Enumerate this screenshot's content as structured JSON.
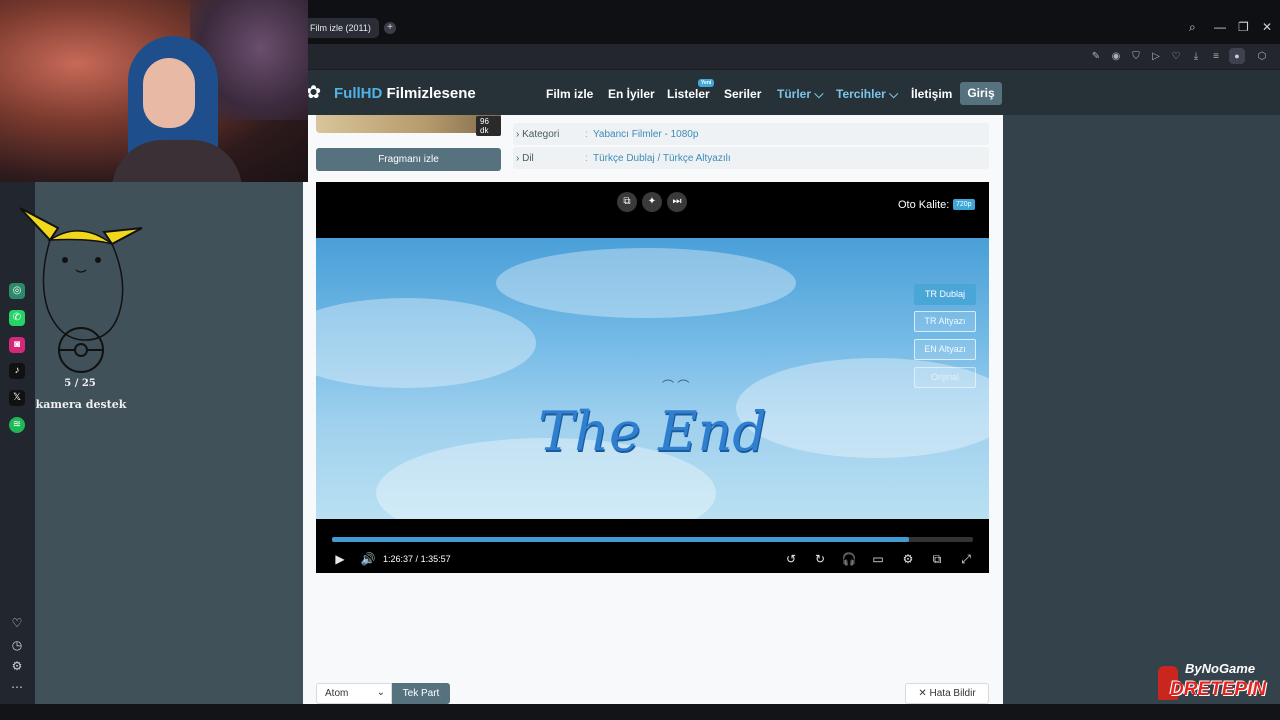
{
  "browser": {
    "tab_title": "Film izle (2011)",
    "new_tab": "+",
    "window_controls": [
      "⌕",
      "—",
      "❐",
      "✕"
    ],
    "toolbar_icons": [
      "edit-icon",
      "camera-icon",
      "shield-icon",
      "play-icon",
      "heart-icon",
      "download-icon",
      "menu-icon",
      "profile-icon"
    ]
  },
  "stream_overlay": {
    "goal_progress": "5 / 25",
    "goal_label": "kamera destek",
    "brand_line1": "ByNoGame",
    "brand_line2": "DRETEPIN",
    "social_icons": [
      "chatgpt-icon",
      "whatsapp-icon",
      "instagram-icon",
      "tiktok-icon",
      "x-icon",
      "spotify-icon"
    ],
    "sidebar_bottom_icons": [
      "heart-icon",
      "clock-icon",
      "gear-icon",
      "more-icon"
    ]
  },
  "site": {
    "logo_part1": "FullHD",
    "logo_part2": "Filmizlesene",
    "nav": {
      "film_izle": "Film izle",
      "en_iyiler": "En İyiler",
      "listeler": "Listeler",
      "listeler_badge": "Yeni",
      "seriler": "Seriler",
      "turler": "Türler ⌵",
      "tercihler": "Tercihler ⌵",
      "iletisim": "İletişim",
      "giris": "Giriş"
    },
    "movie": {
      "duration": "96 dk",
      "trailer_button": "Fragmanı izle",
      "info": [
        {
          "key": "Kategori",
          "value": "Yabancı Filmler - 1080p"
        },
        {
          "key": "Dil",
          "value": "Türkçe Dublaj / Türkçe Altyazılı"
        }
      ]
    },
    "player": {
      "quality_label": "Oto Kalite:",
      "quality_value": "720p",
      "video_text": "The End",
      "audio_options": [
        "TR Dublaj",
        "TR Altyazı",
        "EN Altyazı",
        "Orijinal"
      ],
      "selected_audio": "TR Dublaj",
      "current_time": "1:26:37",
      "time_separator": "/",
      "total_time": "1:35:57",
      "progress": 0.9
    },
    "bottom": {
      "server": "Atom",
      "part": "Tek Part",
      "report": "Hata Bildir"
    }
  }
}
